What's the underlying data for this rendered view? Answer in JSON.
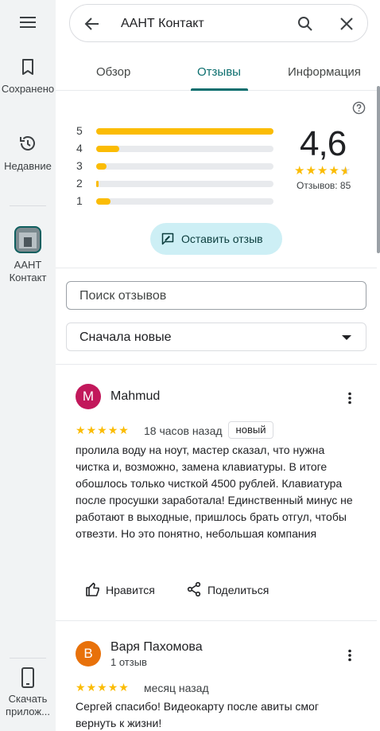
{
  "rail": {
    "saved_label": "Сохранено",
    "recent_label": "Недавние",
    "place_label": "ААНТ Контакт",
    "download_label": "Скачать прилож..."
  },
  "search": {
    "query": "ААНТ Контакт"
  },
  "tabs": [
    {
      "label": "Обзор"
    },
    {
      "label": "Отзывы",
      "active": true
    },
    {
      "label": "Информация"
    }
  ],
  "rating": {
    "average": "4,6",
    "count_text": "Отзывов: 85",
    "histogram": [
      {
        "star": "5",
        "fraction": 1.0
      },
      {
        "star": "4",
        "fraction": 0.13
      },
      {
        "star": "3",
        "fraction": 0.06
      },
      {
        "star": "2",
        "fraction": 0.01
      },
      {
        "star": "1",
        "fraction": 0.08
      }
    ],
    "stars_value": 4.6
  },
  "write_review_label": "Оставить отзыв",
  "review_search_placeholder": "Поиск отзывов",
  "sort": {
    "selected": "Сначала новые"
  },
  "reviews": [
    {
      "avatar_letter": "M",
      "avatar_color": "#c2185b",
      "name": "Mahmud",
      "meta": "",
      "stars": 5,
      "date": "18 часов назад",
      "badge": "новый",
      "text": "пролила воду на ноут, мастер сказал, что нужна чистка и, возможно, замена клавиатуры. В итоге обошлось только чисткой 4500 рублей. Клавиатура после просушки заработала! Единственный минус не работают в выходные, пришлось брать отгул, чтобы отвезти. Но это понятно, небольшая компания",
      "like_label": "Нравится",
      "share_label": "Поделиться"
    },
    {
      "avatar_letter": "В",
      "avatar_color": "#e8710a",
      "name": "Варя Пахомова",
      "meta": "1 отзыв",
      "stars": 5,
      "date": "месяц назад",
      "text": "Сергей спасибо! Видеокарту после авиты смог вернуть к жизни!"
    }
  ],
  "colors": {
    "accent": "#0b6e6e",
    "star": "#fbbc04",
    "write_button_bg": "#cdeff5"
  }
}
